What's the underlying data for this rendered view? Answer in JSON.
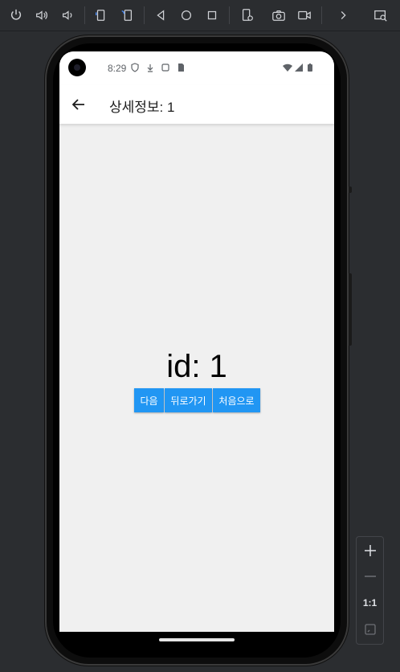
{
  "toolbar": {
    "icons": [
      "power-icon",
      "volume-up-icon",
      "volume-down-icon",
      "rotate-left-icon",
      "rotate-right-icon",
      "back-icon",
      "home-icon",
      "overview-icon",
      "device-settings-icon",
      "camera-icon",
      "video-icon",
      "chevron-right-icon",
      "window-icon"
    ]
  },
  "status_bar": {
    "time": "8:29"
  },
  "app_bar": {
    "title": "상세정보: 1"
  },
  "main": {
    "id_text": "id: 1",
    "buttons": {
      "next": "다음",
      "back": "뒤로가기",
      "first": "처음으로"
    },
    "button_color": "#2196f3"
  },
  "zoom": {
    "ratio_label": "1:1"
  }
}
